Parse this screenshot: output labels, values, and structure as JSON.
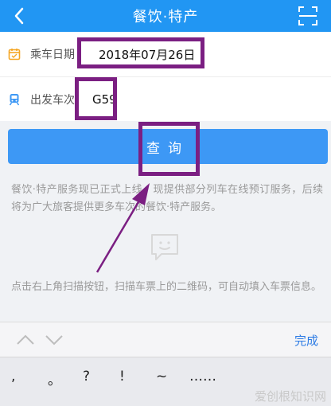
{
  "header": {
    "title": "餐饮·特产"
  },
  "form": {
    "date_label": "乘车日期",
    "date_value": "2018年07月26日",
    "train_label": "出发车次",
    "train_value": "G59"
  },
  "query_button": {
    "label": "查询"
  },
  "info_text": "餐饮·特产服务现已正式上线，现提供部分列车在线预订服务，后续将为广大旅客提供更多车次的餐饮·特产服务。",
  "scan_tip": "点击右上角扫描按钮，扫描车票上的二维码，可自动填入车票信息。",
  "keyboard": {
    "done_label": "完成",
    "keys": [
      ",",
      "。",
      "?",
      "!",
      "~",
      "……"
    ]
  },
  "watermark": "爱创根知识网",
  "colors": {
    "header_bg": "#2196f3",
    "button_bg": "#3d98f5",
    "highlight": "#7b1f82",
    "done_text": "#2c7be5"
  }
}
